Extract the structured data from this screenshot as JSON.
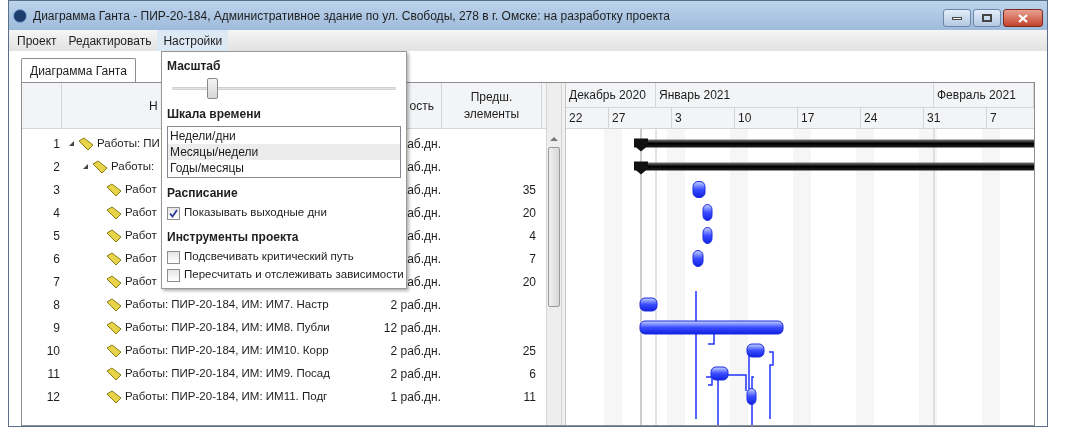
{
  "window": {
    "title": "Диаграмма Ганта - ПИР-20-184, Административное здание по ул. Свободы, 278 в г. Омске: на разработку проекта"
  },
  "menu": [
    {
      "label": "Проект",
      "selected": false
    },
    {
      "label": "Редактировать",
      "selected": false
    },
    {
      "label": "Настройки",
      "selected": true
    }
  ],
  "tabs": [
    {
      "label": "Диаграмма Ганта",
      "selected": true
    }
  ],
  "grid": {
    "columns": [
      {
        "label": "Н"
      },
      {
        "label": "ость"
      },
      {
        "label": "Предш. элементы"
      }
    ],
    "rows": [
      {
        "number": "1",
        "name": "Работы: ПИ",
        "duration": "аб.дн.",
        "expanded": true,
        "children": [
          {
            "number": "2",
            "name": "Работы:",
            "duration": "аб.дн.",
            "expanded": true,
            "children": [
              {
                "number": "3",
                "name": "Работ",
                "duration": "аб.дн.",
                "predecessors": "35"
              },
              {
                "number": "4",
                "name": "Работ",
                "duration": "аб.дн.",
                "predecessors": "20"
              },
              {
                "number": "5",
                "name": "Работ",
                "duration": "аб.дн.",
                "predecessors": "4"
              },
              {
                "number": "6",
                "name": "Работ",
                "duration": "аб.дн.",
                "predecessors": "7"
              },
              {
                "number": "7",
                "name": "Работ",
                "duration": "аб.дн.",
                "predecessors": "20"
              },
              {
                "number": "8",
                "name": "Работы: ПИР-20-184, ИМ: ИМ7. Настр",
                "duration": "2 раб.дн."
              },
              {
                "number": "9",
                "name": "Работы: ПИР-20-184, ИМ: ИМ8. Публи",
                "duration": "12 раб.дн."
              },
              {
                "number": "10",
                "name": "Работы: ПИР-20-184, ИМ: ИМ10. Корр",
                "duration": "2 раб.дн.",
                "predecessors": "25"
              },
              {
                "number": "11",
                "name": "Работы: ПИР-20-184, ИМ: ИМ9. Посад",
                "duration": "2 раб.дн.",
                "predecessors": "6"
              },
              {
                "number": "12",
                "name": "Работы: ПИР-20-184, ИМ: ИМ11. Подг",
                "duration": "1 раб.дн.",
                "predecessors": "11"
              }
            ]
          }
        ]
      }
    ]
  },
  "timeline": {
    "months": [
      "Декабрь 2020",
      "Январь 2021",
      "Февраль 2021"
    ],
    "days": [
      "22",
      "27",
      "3",
      "10",
      "17",
      "24",
      "31",
      "7"
    ]
  },
  "settings_popup": {
    "scale": {
      "title": "Масштаб",
      "level": 0.18
    },
    "timescale": {
      "title": "Шкала времени",
      "options": [
        {
          "label": "Недели/дни",
          "selected": false
        },
        {
          "label": "Месяцы/недели",
          "selected": true
        },
        {
          "label": "Годы/месяцы",
          "selected": false
        }
      ]
    },
    "schedule": {
      "title": "Расписание",
      "options": [
        {
          "label": "Показывать выходные дни",
          "checked": true
        }
      ]
    },
    "tools": {
      "title": "Инструменты проекта",
      "options": [
        {
          "label": "Подсвечивать критический путь",
          "checked": false
        },
        {
          "label": "Пересчитать и отслеживать зависимости",
          "checked": false
        }
      ]
    }
  }
}
